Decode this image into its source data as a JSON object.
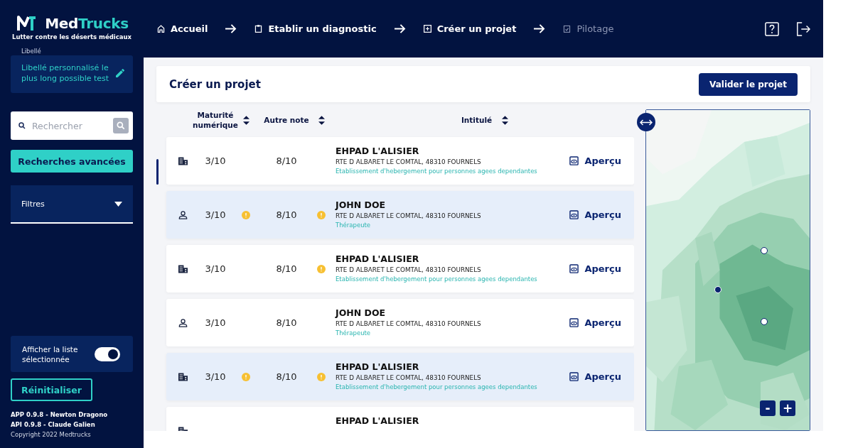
{
  "brand": {
    "name_main": "Med",
    "name_accent": "Trucks",
    "tagline": "Lutter contre les déserts médicaux"
  },
  "nav": [
    {
      "label": "Accueil",
      "kind": "home",
      "disabled": false
    },
    {
      "label": "Etablir un diagnostic",
      "kind": "clipboard",
      "disabled": false
    },
    {
      "label": "Créer un projet",
      "kind": "plus",
      "disabled": false
    },
    {
      "label": "Pilotage",
      "kind": "check",
      "disabled": true
    }
  ],
  "sidebar": {
    "libelle_label": "Libellé",
    "libelle_value": "Libellé personnalisé le plus long possible test",
    "search_placeholder": "Rechercher",
    "advanced_button": "Recherches avancées",
    "filters_label": "Filtres",
    "toggle_label": "Afficher la liste sélectionnée",
    "toggle_on": true,
    "reset_button": "Réinitialiser",
    "versions": [
      "APP 0.9.8 - Newton Dragono",
      "API 0.9.8 - Claude Galien"
    ],
    "copyright": "Copyright 2022 Medtrucks"
  },
  "page_title": "Créer un projet",
  "validate_button": "Valider le projet",
  "table": {
    "columns": [
      "Maturité numérique",
      "Autre note",
      "Intitulé"
    ],
    "rows": [
      {
        "kind": "building",
        "maturity": "3/10",
        "maturity_warning": false,
        "other": "8/10",
        "other_warning": false,
        "name": "EHPAD L'ALISIER",
        "address": "RTE D ALBARET LE COMTAL, 48310 FOURNELS",
        "type": "Etablissement d'hebergement pour personnes agees dependantes",
        "action": "Aperçu",
        "selected": false
      },
      {
        "kind": "person",
        "maturity": "3/10",
        "maturity_warning": true,
        "other": "8/10",
        "other_warning": true,
        "name": "JOHN DOE",
        "address": "RTE D ALBARET LE COMTAL, 48310 FOURNELS",
        "type": "Thérapeute",
        "action": "Aperçu",
        "selected": true
      },
      {
        "kind": "building",
        "maturity": "3/10",
        "maturity_warning": false,
        "other": "8/10",
        "other_warning": true,
        "name": "EHPAD L'ALISIER",
        "address": "RTE D ALBARET LE COMTAL, 48310 FOURNELS",
        "type": "Etablissement d'hebergement pour personnes agees dependantes",
        "action": "Aperçu",
        "selected": false
      },
      {
        "kind": "person",
        "maturity": "3/10",
        "maturity_warning": false,
        "other": "8/10",
        "other_warning": false,
        "name": "JOHN DOE",
        "address": "RTE D ALBARET LE COMTAL, 48310 FOURNELS",
        "type": "Thérapeute",
        "action": "Aperçu",
        "selected": false
      },
      {
        "kind": "building",
        "maturity": "3/10",
        "maturity_warning": true,
        "other": "8/10",
        "other_warning": true,
        "name": "EHPAD L'ALISIER",
        "address": "RTE D ALBARET LE COMTAL, 48310 FOURNELS",
        "type": "Etablissement d'hebergement pour personnes agees dependantes",
        "action": "Aperçu",
        "selected": true
      },
      {
        "kind": "building",
        "name": "EHPAD L'ALISIER",
        "selected": false
      }
    ]
  },
  "map": {
    "zoom_out": "-",
    "zoom_in": "+"
  }
}
